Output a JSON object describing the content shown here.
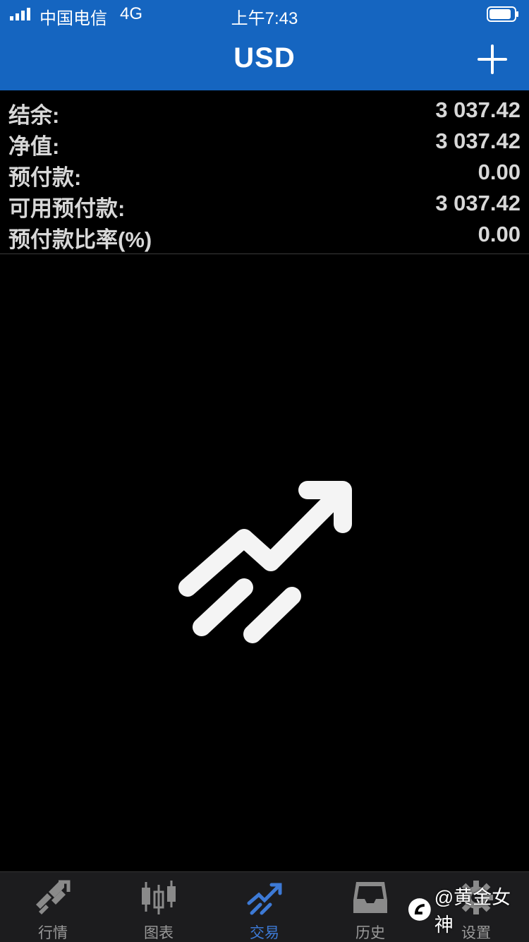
{
  "status_bar": {
    "carrier": "中国电信",
    "network": "4G",
    "time": "上午7:43"
  },
  "nav": {
    "title": "USD",
    "add_icon": "plus-icon"
  },
  "account": {
    "rows": [
      {
        "label": "结余:",
        "value": "3 037.42"
      },
      {
        "label": "净值:",
        "value": "3 037.42"
      },
      {
        "label": "预付款:",
        "value": "0.00"
      },
      {
        "label": "可用预付款:",
        "value": "3 037.42"
      },
      {
        "label": "预付款比率(%)",
        "value": "0.00"
      }
    ]
  },
  "empty_state": {
    "icon": "trade-arrow-icon"
  },
  "tabs": [
    {
      "label": "行情",
      "icon": "quotes-icon",
      "active": false
    },
    {
      "label": "图表",
      "icon": "candlestick-icon",
      "active": false
    },
    {
      "label": "交易",
      "icon": "trade-icon",
      "active": true
    },
    {
      "label": "历史",
      "icon": "history-inbox-icon",
      "active": false
    },
    {
      "label": "设置",
      "icon": "gear-icon",
      "active": false
    }
  ],
  "watermark": {
    "text": "@黄金女神"
  },
  "colors": {
    "header_blue": "#1565c0",
    "active_tab": "#3d7ad6",
    "inactive_tab": "#9a9a9a"
  }
}
